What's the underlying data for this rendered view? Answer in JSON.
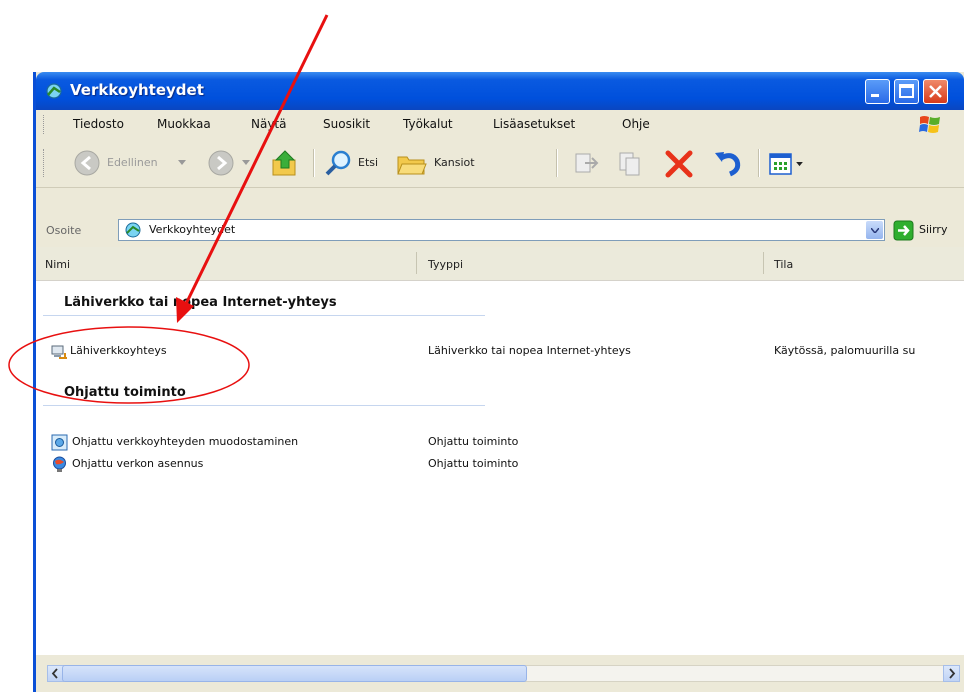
{
  "window": {
    "title": "Verkkoyhteydet",
    "title_icon": "network-connections-icon"
  },
  "menu": {
    "items": [
      "Tiedosto",
      "Muokkaa",
      "Näytä",
      "Suosikit",
      "Työkalut",
      "Lisäasetukset",
      "Ohje"
    ]
  },
  "toolbar": {
    "back_label": "Edellinen",
    "search_label": "Etsi",
    "folders_label": "Kansiot"
  },
  "address": {
    "label": "Osoite",
    "value": "Verkkoyhteydet",
    "go_label": "Siirry"
  },
  "columns": {
    "name": "Nimi",
    "type": "Tyyppi",
    "status": "Tila"
  },
  "groups": [
    {
      "title": "Lähiverkko tai nopea Internet-yhteys",
      "rows": [
        {
          "name": "Lähiverkkoyhteys",
          "type": "Lähiverkko tai nopea Internet-yhteys",
          "status": "Käytössä, palomuurilla su"
        }
      ]
    },
    {
      "title": "Ohjattu toiminto",
      "rows": [
        {
          "name": "Ohjattu verkkoyhteyden muodostaminen",
          "type": "Ohjattu toiminto",
          "status": ""
        },
        {
          "name": "Ohjattu verkon asennus",
          "type": "Ohjattu toiminto",
          "status": ""
        }
      ]
    }
  ],
  "colors": {
    "titlebar": "#0a5ae0",
    "annotation": "#e81010"
  }
}
